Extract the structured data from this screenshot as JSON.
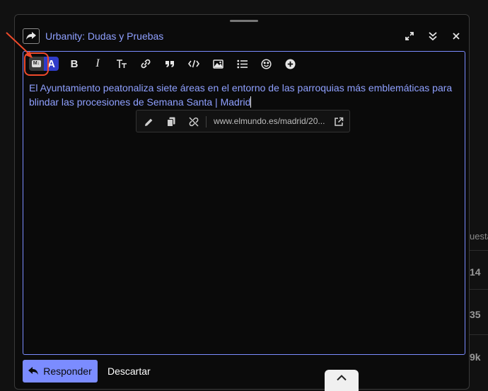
{
  "composer": {
    "topic_title": "Urbanity: Dudas y Pruebas",
    "controls": [
      "expand-icon",
      "collapse-icon",
      "close-icon"
    ]
  },
  "toolbar": {
    "items": [
      "markdown-toggle",
      "bold",
      "italic",
      "heading",
      "link",
      "quote",
      "code",
      "image",
      "list",
      "emoji",
      "plus"
    ],
    "rich_text_glyph": "A",
    "md_glyph": "M↓",
    "bold_glyph": "B",
    "italic_glyph": "I"
  },
  "editor": {
    "text": "El Ayuntamiento peatonaliza siete áreas en el entorno de las parroquias más emblemáticas para blindar las procesiones de Semana Santa | Madrid"
  },
  "link_popup": {
    "url": "www.elmundo.es/madrid/20..."
  },
  "actions": {
    "reply_label": "Responder",
    "discard_label": "Descartar"
  },
  "background": {
    "header_fragment": "uesta",
    "values": [
      "14",
      "35",
      "9k"
    ]
  },
  "colors": {
    "accent": "#7b8cff",
    "link_text": "#8fa0ff",
    "rich_text_active": "#2f3cc9",
    "annotation": "#ee4a2b"
  }
}
